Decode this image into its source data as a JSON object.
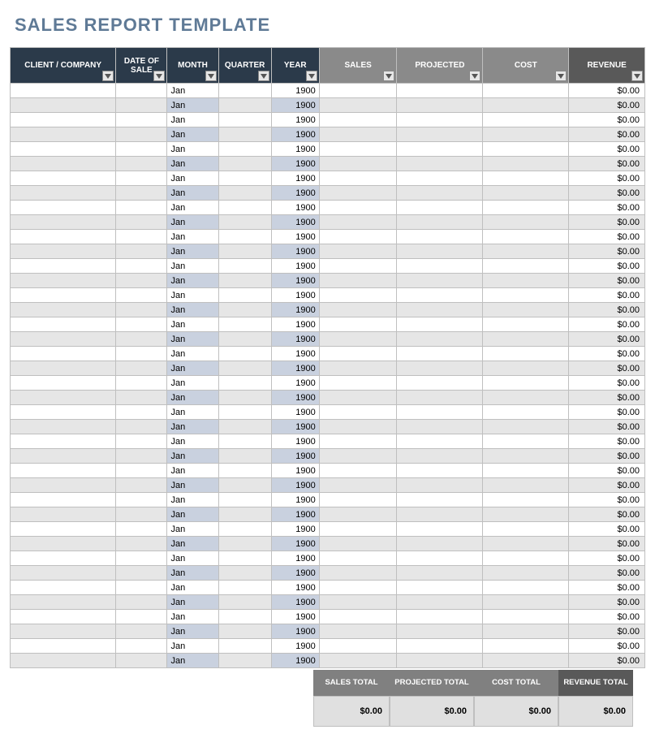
{
  "title": "SALES REPORT TEMPLATE",
  "columns": {
    "client": "CLIENT / COMPANY",
    "date": "DATE OF SALE",
    "month": "MONTH",
    "quarter": "QUARTER",
    "year": "YEAR",
    "sales": "SALES",
    "projected": "PROJECTED",
    "cost": "COST",
    "revenue": "REVENUE"
  },
  "row_count": 40,
  "row_defaults": {
    "client": "",
    "date": "",
    "month": "Jan",
    "quarter": "",
    "year": "1900",
    "sales": "",
    "projected": "",
    "cost": "",
    "revenue": "$0.00"
  },
  "totals": {
    "sales_label": "SALES TOTAL",
    "projected_label": "PROJECTED TOTAL",
    "cost_label": "COST TOTAL",
    "revenue_label": "REVENUE TOTAL",
    "sales_value": "$0.00",
    "projected_value": "$0.00",
    "cost_value": "$0.00",
    "revenue_value": "$0.00"
  }
}
